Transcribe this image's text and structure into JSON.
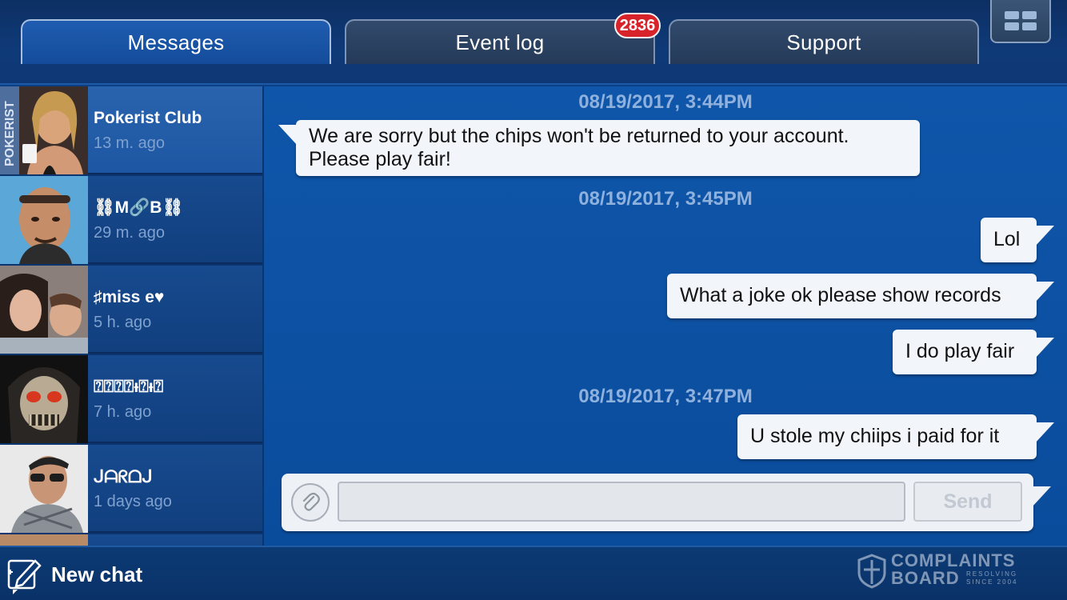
{
  "tabs": {
    "messages": "Messages",
    "event_log": "Event log",
    "support": "Support",
    "event_log_badge": "2836",
    "active": "messages"
  },
  "menu": {
    "icon": "grid-menu-icon"
  },
  "contacts": [
    {
      "name": "Pokerist Club",
      "time": "13 m. ago",
      "active": true,
      "avatar_label": "POKERIST"
    },
    {
      "name": "⛓M🔗B⛓",
      "time": "29 m. ago",
      "active": false
    },
    {
      "name": "♯miss e♥",
      "time": "5 h. ago",
      "active": false
    },
    {
      "name": "⍰⍰⍰⍰ᵻ⍰ᵻ⍰",
      "time": "7 h. ago",
      "active": false
    },
    {
      "name": "ᒍᗩᖇᗝᒍ",
      "time": "1 days ago",
      "active": false
    }
  ],
  "chat": {
    "timestamps": [
      "08/19/2017, 3:44PM",
      "08/19/2017, 3:45PM",
      "08/19/2017, 3:47PM"
    ],
    "messages": [
      {
        "direction": "in",
        "text_line1": "We are sorry but the chips won't be returned to your account.",
        "text_line2": "Please play fair!"
      },
      {
        "direction": "out",
        "text": "Lol"
      },
      {
        "direction": "out",
        "text": "What a joke ok please show records"
      },
      {
        "direction": "out",
        "text": "I do play fair"
      },
      {
        "direction": "out",
        "text": "U stole my chiips i paid for it"
      }
    ]
  },
  "composer": {
    "input_value": "",
    "send_label": "Send",
    "attach_icon": "paperclip-icon"
  },
  "bottom": {
    "new_chat_label": "New chat",
    "new_chat_icon": "compose-icon",
    "watermark_line1": "COMPLAINTS",
    "watermark_line2": "BOARD",
    "watermark_line3": "RESOLVING SINCE 2004"
  },
  "colors": {
    "background": "#0c3f86",
    "chat_background": "#0f56aa",
    "badge": "#d8232a",
    "bubble": "#f2f5f9",
    "timestamp": "#8fb1dd",
    "contact_time": "#7fa1cf"
  }
}
